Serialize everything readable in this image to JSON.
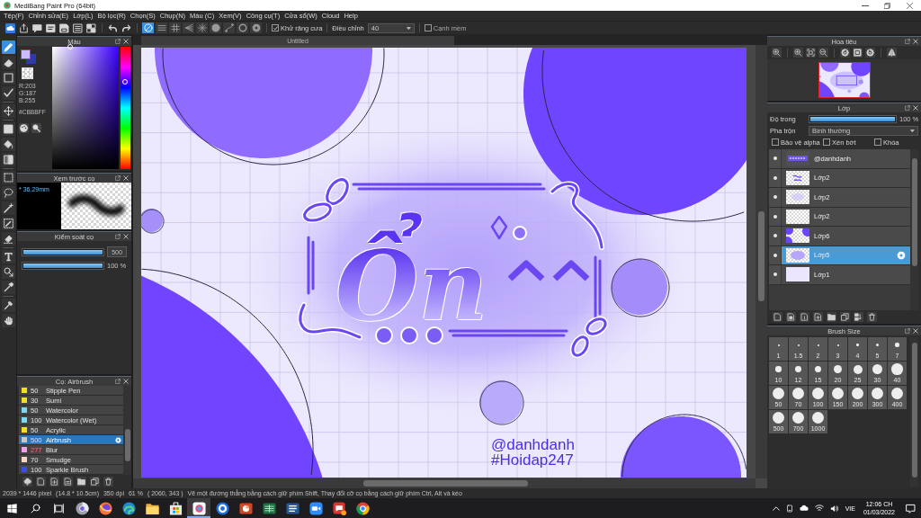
{
  "window": {
    "title": "MediBang Paint Pro (64bit)"
  },
  "menu": [
    "Tệp(F)",
    "Chỉnh sửa(E)",
    "Lớp(L)",
    "Bộ lọc(R)",
    "Chọn(S)",
    "Chụp(N)",
    "Màu (C)",
    "Xem(V)",
    "Công cụ(T)",
    "Cửa sổ(W)",
    "Cloud",
    "Help"
  ],
  "toolbar": {
    "snaps": [
      {
        "kind": "off",
        "selected": true
      },
      {
        "kind": "parallel",
        "selected": false
      },
      {
        "kind": "cross",
        "selected": false
      },
      {
        "kind": "perspective",
        "selected": false
      },
      {
        "kind": "radial",
        "selected": false
      },
      {
        "kind": "concentric",
        "selected": false
      },
      {
        "kind": "curve",
        "selected": false
      },
      {
        "kind": "circle",
        "selected": false
      },
      {
        "kind": "settings",
        "selected": false
      }
    ],
    "antialias": {
      "label": "Khử răng cưa",
      "checked": true
    },
    "correction": {
      "label": "Điều chỉnh",
      "value": "40"
    },
    "soft_edge": {
      "label": "Cạnh mềm",
      "checked": false
    }
  },
  "tools": [
    {
      "kind": "brush",
      "selected": true
    },
    {
      "kind": "eraser",
      "selected": false
    },
    {
      "kind": "dot",
      "selected": false
    },
    {
      "kind": "check",
      "selected": false
    },
    {
      "kind": "move",
      "selected": false
    },
    {
      "kind": "fill",
      "selected": false
    },
    {
      "kind": "bucket",
      "selected": false
    },
    {
      "kind": "gradient",
      "selected": false
    },
    {
      "kind": "select",
      "selected": false
    },
    {
      "kind": "lasso",
      "selected": false
    },
    {
      "kind": "wand",
      "selected": false
    },
    {
      "kind": "select_pen",
      "selected": false
    },
    {
      "kind": "select_eraser",
      "selected": false
    },
    {
      "kind": "text",
      "selected": false
    },
    {
      "kind": "operation",
      "selected": false
    },
    {
      "kind": "eyedropper",
      "selected": false
    },
    {
      "kind": "dropper",
      "selected": false
    },
    {
      "kind": "hand",
      "selected": false
    }
  ],
  "color_panel": {
    "title": "Màu",
    "rgb": [
      "R:203",
      "G:187",
      "B:255"
    ],
    "hex": "#CBBBFF",
    "hue": {
      "level": 0.71
    }
  },
  "brush_preview": {
    "title": "Xem trước cọ",
    "size": "* 36.29mm"
  },
  "brush_control": {
    "title": "Kiểm soát cọ",
    "sliders": [
      {
        "kind": "size",
        "level": 1,
        "value": "500"
      },
      {
        "kind": "opacity",
        "level": 1,
        "value": "100 %"
      }
    ]
  },
  "brushes": {
    "title": "Cọ: Airbrush",
    "items": [
      {
        "size": "50",
        "name": "Stipple Pen",
        "color": "#f0e020",
        "warning": false,
        "selected": false
      },
      {
        "size": "30",
        "name": "Sumi",
        "color": "#f0e020",
        "warning": false,
        "selected": false
      },
      {
        "size": "50",
        "name": "Watercolor",
        "color": "#7fd8f2",
        "warning": false,
        "selected": false
      },
      {
        "size": "100",
        "name": "Watercolor (Wet)",
        "color": "#7fd8f2",
        "warning": false,
        "selected": false
      },
      {
        "size": "50",
        "name": "Acrylic",
        "color": "#f0e020",
        "warning": false,
        "selected": false
      },
      {
        "size": "500",
        "name": "Airbrush",
        "color": "#c8c8c8",
        "warning": true,
        "selected": true
      },
      {
        "size": "277",
        "name": "Blur",
        "color": "#f3a0ec",
        "warning": true,
        "selected": false
      },
      {
        "size": "70",
        "name": "Smudge",
        "color": "#f8d8c4",
        "warning": false,
        "selected": false
      },
      {
        "size": "100",
        "name": "Sparkle Brush",
        "color": "#3a4ee8",
        "warning": false,
        "selected": false
      }
    ]
  },
  "canvas": {
    "tab": "Untitled",
    "lettering": "Ổn",
    "signature": [
      "@danhdanh",
      "#Hoidap247"
    ]
  },
  "navigator": {
    "title": "Hoa tiêu"
  },
  "layers": {
    "title": "Lớp",
    "opacity": {
      "label": "Độ trong",
      "level": 1,
      "value": "100 %"
    },
    "blend": {
      "label": "Pha trộn",
      "value": "Bình thường"
    },
    "options": [
      {
        "label": "Bảo vệ alpha",
        "checked": false
      },
      {
        "label": "Xén bớt",
        "checked": false
      },
      {
        "label": "Khóa",
        "checked": false
      }
    ],
    "items": [
      {
        "name": "@danhdanh",
        "visible": true,
        "selected": false
      },
      {
        "name": "Lớp2",
        "visible": true,
        "selected": false
      },
      {
        "name": "Lớp2",
        "visible": true,
        "selected": false
      },
      {
        "name": "Lớp2",
        "visible": true,
        "selected": false
      },
      {
        "name": "Lớp6",
        "visible": true,
        "selected": false
      },
      {
        "name": "Lớp5",
        "visible": true,
        "selected": true
      },
      {
        "name": "Lớp1",
        "visible": true,
        "selected": false
      }
    ]
  },
  "brush_size": {
    "title": "Brush Size",
    "sizes": [
      "1",
      "1.5",
      "2",
      "3",
      "4",
      "5",
      "7",
      "10",
      "12",
      "15",
      "20",
      "25",
      "30",
      "40",
      "50",
      "70",
      "100",
      "150",
      "200",
      "300",
      "400",
      "500",
      "700",
      "1000"
    ]
  },
  "status_bar": [
    "2039 * 1446 pixel",
    "(14.8 * 10.5cm)",
    "350 dpi",
    "61 %",
    "( 2060, 343 )",
    "Vẽ một đường thẳng bằng cách giữ phím Shift, Thay đổi cỡ cọ bằng cách giữ phím Ctrl, Alt và kéo"
  ],
  "taskbar": {
    "apps": [
      {
        "kind": "browser_dev",
        "active": false
      },
      {
        "kind": "firefox",
        "active": false
      },
      {
        "kind": "edge",
        "active": false
      },
      {
        "kind": "explorer",
        "active": false
      },
      {
        "kind": "store",
        "active": false
      },
      {
        "kind": "paint",
        "active": true
      },
      {
        "kind": "coccoc",
        "active": false
      },
      {
        "kind": "powerpoint",
        "active": false
      },
      {
        "kind": "excel",
        "active": false
      },
      {
        "kind": "word",
        "active": false
      },
      {
        "kind": "zoom",
        "active": false
      },
      {
        "kind": "chat",
        "active": false
      },
      {
        "kind": "chrome",
        "active": false
      }
    ],
    "language": "VIE",
    "time": "12:06 CH",
    "date": "01/03/2022"
  }
}
